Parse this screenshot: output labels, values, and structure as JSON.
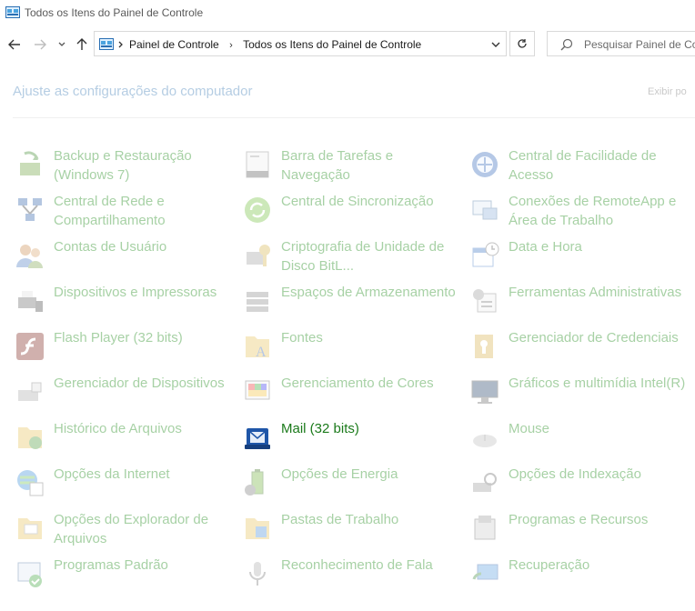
{
  "window": {
    "title": "Todos os Itens do Painel de Controle"
  },
  "address": {
    "crumbs": [
      "Painel de Controle",
      "Todos os Itens do Painel de Controle"
    ]
  },
  "search": {
    "placeholder": "Pesquisar Painel de Co"
  },
  "heading": "Ajuste as configurações do computador",
  "view_by": "Exibir po",
  "items": [
    {
      "label": "Backup e Restauração (Windows 7)",
      "icon": "backup-icon"
    },
    {
      "label": "Barra de Tarefas e Navegação",
      "icon": "taskbar-icon"
    },
    {
      "label": "Central de Facilidade de Acesso",
      "icon": "accessibility-icon"
    },
    {
      "label": "Central de Rede e Compartilhamento",
      "icon": "network-icon"
    },
    {
      "label": "Central de Sincronização",
      "icon": "sync-icon"
    },
    {
      "label": "Conexões de RemoteApp e Área de Trabalho",
      "icon": "remoteapp-icon"
    },
    {
      "label": "Contas de Usuário",
      "icon": "users-icon"
    },
    {
      "label": "Criptografia de Unidade de Disco BitL...",
      "icon": "bitlocker-icon"
    },
    {
      "label": "Data e Hora",
      "icon": "calendar-icon"
    },
    {
      "label": "Dispositivos e Impressoras",
      "icon": "printer-icon"
    },
    {
      "label": "Espaços de Armazenamento",
      "icon": "storage-icon"
    },
    {
      "label": "Ferramentas Administrativas",
      "icon": "admin-tools-icon"
    },
    {
      "label": "Flash Player (32 bits)",
      "icon": "flash-icon"
    },
    {
      "label": "Fontes",
      "icon": "fonts-icon"
    },
    {
      "label": "Gerenciador de Credenciais",
      "icon": "credentials-icon"
    },
    {
      "label": "Gerenciador de Dispositivos",
      "icon": "device-manager-icon"
    },
    {
      "label": "Gerenciamento de Cores",
      "icon": "color-management-icon"
    },
    {
      "label": "Gráficos e multimídia Intel(R)",
      "icon": "intel-graphics-icon"
    },
    {
      "label": "Histórico de Arquivos",
      "icon": "file-history-icon"
    },
    {
      "label": "Mail (32 bits)",
      "icon": "mail-icon",
      "active": true
    },
    {
      "label": "Mouse",
      "icon": "mouse-icon"
    },
    {
      "label": "Opções da Internet",
      "icon": "internet-options-icon"
    },
    {
      "label": "Opções de Energia",
      "icon": "power-icon"
    },
    {
      "label": "Opções de Indexação",
      "icon": "indexing-icon"
    },
    {
      "label": "Opções do Explorador de Arquivos",
      "icon": "explorer-options-icon"
    },
    {
      "label": "Pastas de Trabalho",
      "icon": "work-folders-icon"
    },
    {
      "label": "Programas e Recursos",
      "icon": "programs-icon"
    },
    {
      "label": "Programas Padrão",
      "icon": "default-programs-icon"
    },
    {
      "label": "Reconhecimento de Fala",
      "icon": "microphone-icon"
    },
    {
      "label": "Recuperação",
      "icon": "recovery-icon"
    }
  ]
}
